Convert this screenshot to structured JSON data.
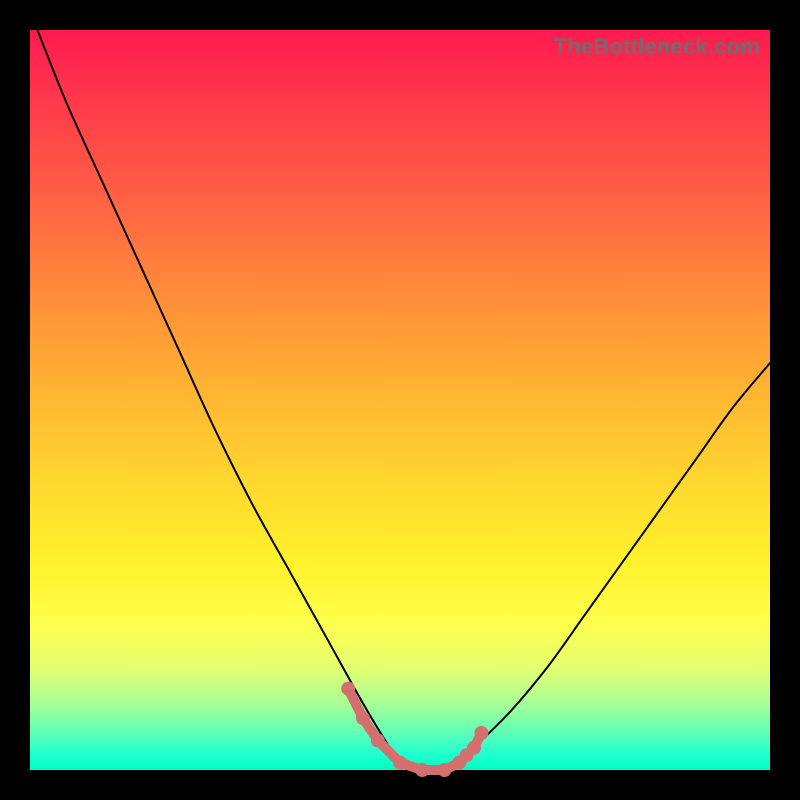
{
  "watermark": "TheBottleneck.com",
  "colors": {
    "frame": "#000000",
    "curve": "#000000",
    "markers": "#d46f6f",
    "gradient_top": "#ff1a50",
    "gradient_bottom": "#00ffc0"
  },
  "chart_data": {
    "type": "line",
    "title": "",
    "xlabel": "",
    "ylabel": "",
    "xlim": [
      0,
      100
    ],
    "ylim": [
      0,
      100
    ],
    "grid": false,
    "legend": false,
    "series": [
      {
        "name": "bottleneck-curve",
        "x": [
          1,
          5,
          10,
          15,
          20,
          25,
          30,
          35,
          40,
          45,
          48,
          50,
          52,
          55,
          58,
          60,
          65,
          70,
          75,
          80,
          85,
          90,
          95,
          100
        ],
        "y": [
          100,
          90,
          79,
          68,
          57,
          46,
          36,
          27,
          18,
          9,
          4,
          1,
          0,
          0,
          1,
          3,
          8,
          14,
          21,
          28,
          35,
          42,
          49,
          55
        ]
      }
    ],
    "markers": {
      "name": "highlighted-points",
      "x": [
        43,
        45,
        47,
        50,
        53,
        56,
        58,
        59,
        60,
        61
      ],
      "y": [
        11,
        7,
        4,
        1,
        0,
        0,
        1,
        2,
        3,
        5
      ]
    }
  }
}
